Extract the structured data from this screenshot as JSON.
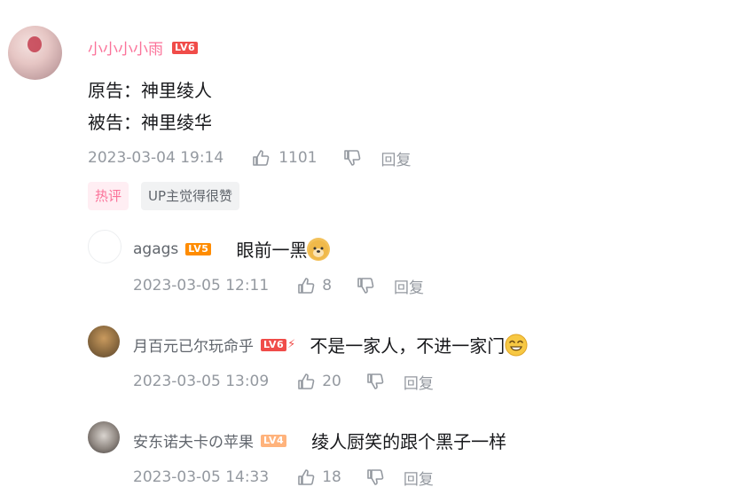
{
  "main_comment": {
    "username": "小小小小雨",
    "level": "LV6",
    "lines": [
      "原告：神里绫人",
      "被告：神里绫华"
    ],
    "time": "2023-03-04 19:14",
    "likes": "1101",
    "reply_label": "回复",
    "tags": [
      "热评",
      "UP主觉得很赞"
    ]
  },
  "replies": [
    {
      "username": "agags",
      "level": "LV5",
      "text": "眼前一黑",
      "emoji": "doge-emoji",
      "time": "2023-03-05 12:11",
      "likes": "8",
      "reply_label": "回复"
    },
    {
      "username": "月百元已尔玩命乎",
      "level": "LV6",
      "text": "不是一家人，不进一家门",
      "emoji": "smile-emoji",
      "time": "2023-03-05 13:09",
      "likes": "20",
      "reply_label": "回复"
    },
    {
      "username": "安东诺夫卡の苹果",
      "level": "LV4",
      "text": "绫人厨笑的跟个黑子一样",
      "emoji": "",
      "time": "2023-03-05 14:33",
      "likes": "18",
      "reply_label": "回复"
    }
  ],
  "colors": {
    "accent": "#fb7299",
    "muted": "#9499a0",
    "lv6": "#f04c49",
    "lv5": "#ff8c00",
    "lv4": "#ffb37c"
  }
}
